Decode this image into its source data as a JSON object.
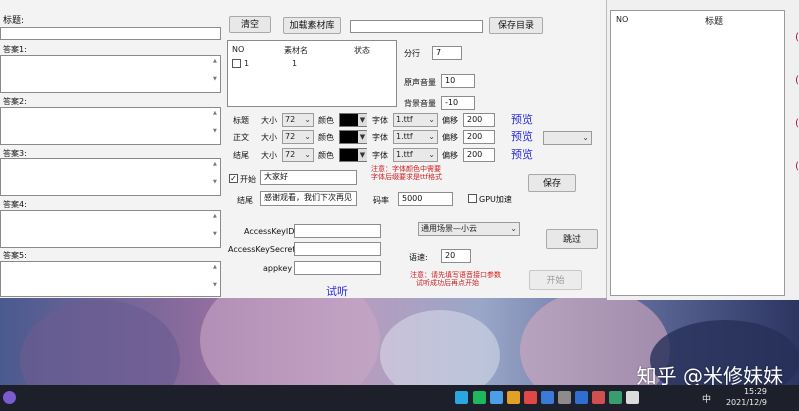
{
  "left": {
    "title_label": "标题:",
    "answers": [
      "答案1:",
      "答案2:",
      "答案3:",
      "答案4:",
      "答案5:"
    ]
  },
  "toolbar": {
    "clear": "清空",
    "load_assets": "加载素材库",
    "save_dir": "保存目录",
    "save_dir_value": ""
  },
  "asset_table": {
    "headers": [
      "NO",
      "素材名",
      "状态"
    ],
    "rows": [
      {
        "no": "1",
        "name": "1",
        "status": ""
      }
    ]
  },
  "rows_label": "分行",
  "rows_value": "7",
  "voice_vol_label": "原声音量",
  "voice_vol_value": "10",
  "bg_vol_label": "背景音量",
  "bg_vol_value": "-10",
  "styles": [
    {
      "name": "标题",
      "size_label": "大小",
      "size": "72",
      "color_label": "颜色",
      "font_label": "字体",
      "font": "1.ttf",
      "offset_label": "偏移",
      "offset": "200",
      "preview": "预览"
    },
    {
      "name": "正文",
      "size_label": "大小",
      "size": "72",
      "color_label": "颜色",
      "font_label": "字体",
      "font": "1.ttf",
      "offset_label": "偏移",
      "offset": "200",
      "preview": "预览"
    },
    {
      "name": "结尾",
      "size_label": "大小",
      "size": "72",
      "color_label": "颜色",
      "font_label": "字体",
      "font": "1.ttf",
      "offset_label": "偏移",
      "offset": "200",
      "preview": "预览"
    }
  ],
  "start_label": "开始",
  "start_value": "大家好",
  "end_label": "结尾",
  "end_value": "感谢观看，我们下次再见",
  "note1": [
    "注意：字体颜色中需要",
    "字体后缀要求是ttf格式"
  ],
  "bitrate_label": "码率",
  "bitrate_value": "5000",
  "gpu_label": "GPU加速",
  "save_btn": "保存",
  "api": {
    "key_id_label": "AccessKeyID",
    "key_secret_label": "AccessKeySecret",
    "appkey_label": "appkey",
    "try_listen": "试听"
  },
  "scene_select": "通用场景—小云",
  "skip_btn": "跳过",
  "speed_label": "语速:",
  "speed_value": "20",
  "note2": [
    "注意：请先填写语音接口参数",
    "试听成功后再点开始"
  ],
  "start_btn": "开始",
  "right_list": {
    "headers": [
      "NO",
      "标题"
    ]
  },
  "watermark": "知乎 @米修妹妹",
  "clock": {
    "time": "15:29",
    "date": "2021/12/9"
  },
  "taskbar_lang": "中",
  "colors": {
    "note_red": "#d02020",
    "link_blue": "#2a2adf"
  }
}
